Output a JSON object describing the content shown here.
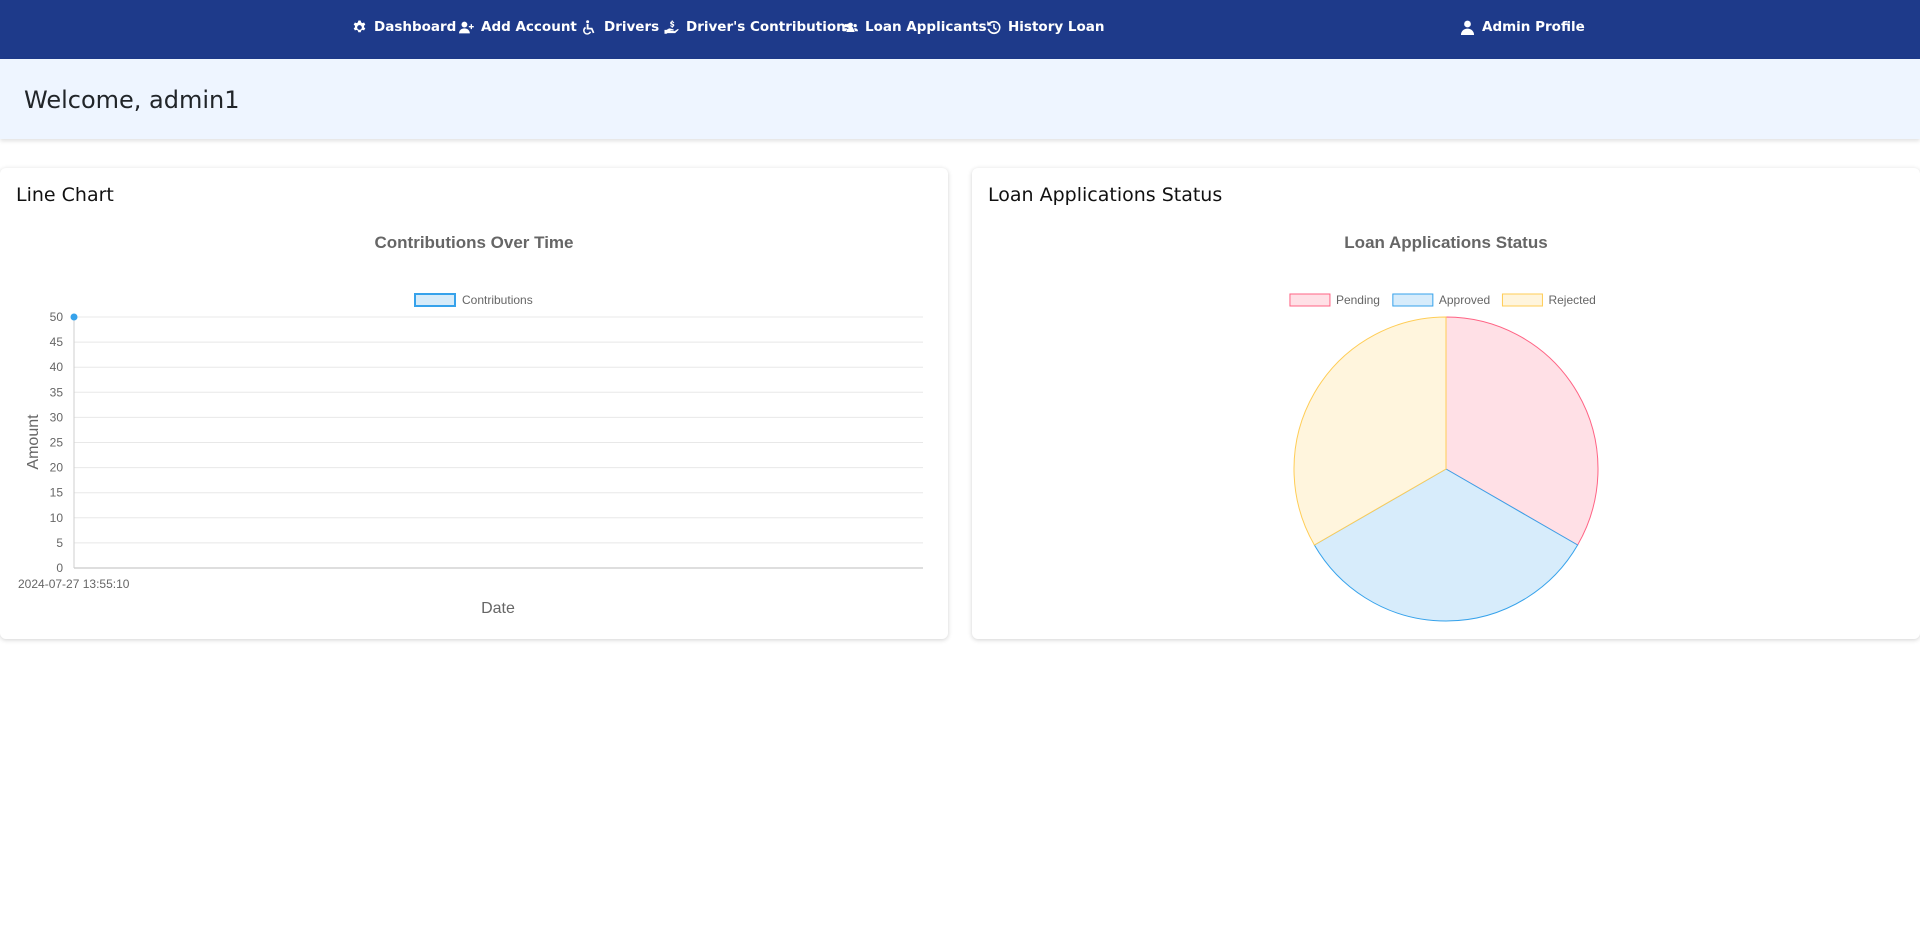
{
  "nav": {
    "items": [
      {
        "label": "Dashboard",
        "icon": "gear-icon"
      },
      {
        "label": "Add Account",
        "icon": "user-plus-icon"
      },
      {
        "label": "Drivers",
        "icon": "wheelchair-icon"
      },
      {
        "label": "Driver's Contributions",
        "icon": "hand-holding-dollar-icon"
      },
      {
        "label": "Loan Applicants",
        "icon": "users-icon"
      },
      {
        "label": "History Loan",
        "icon": "history-icon"
      }
    ],
    "profile": {
      "label": "Admin Profile",
      "icon": "user-icon"
    }
  },
  "welcome": {
    "text": "Welcome, admin1"
  },
  "cards": {
    "line": {
      "title": "Line Chart"
    },
    "pie": {
      "title": "Loan Applications Status"
    }
  },
  "chart_data": [
    {
      "type": "line",
      "title": "Contributions Over Time",
      "xlabel": "Date",
      "ylabel": "Amount",
      "x": [
        "2024-07-27 13:55:10"
      ],
      "series": [
        {
          "name": "Contributions",
          "values": [
            50
          ]
        }
      ],
      "ylim": [
        0,
        50
      ],
      "yticks": [
        0,
        5,
        10,
        15,
        20,
        25,
        30,
        35,
        40,
        45,
        50
      ],
      "grid": true,
      "legend": "top",
      "color": "#36a2eb",
      "fill": "#d6ebf9"
    },
    {
      "type": "pie",
      "title": "Loan Applications Status",
      "categories": [
        "Pending",
        "Approved",
        "Rejected"
      ],
      "values": [
        1,
        1,
        1
      ],
      "legend": "top",
      "colors": [
        "#ff6384",
        "#36a2eb",
        "#ffcd56"
      ],
      "fills": [
        "#ffe0e6",
        "#d7ecfb",
        "#fff5dd"
      ]
    }
  ]
}
